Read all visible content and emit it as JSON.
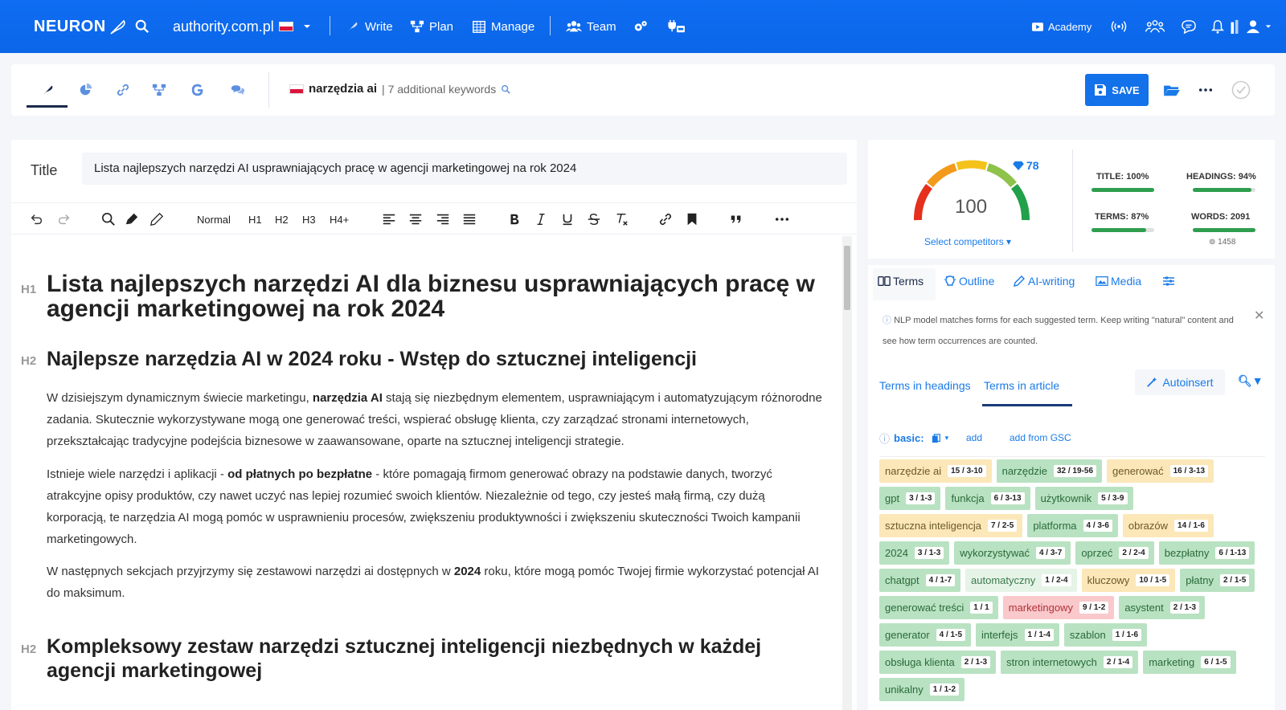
{
  "topnav": {
    "logo": "NEURON",
    "domain": "authority.com.pl",
    "items": {
      "write": "Write",
      "plan": "Plan",
      "manage": "Manage",
      "team": "Team"
    },
    "academy": "Academy"
  },
  "toolbar2": {
    "keyword": "narzędzia ai",
    "additional": "| 7 additional keywords",
    "save": "SAVE"
  },
  "editor": {
    "title_label": "Title",
    "title_value": "Lista najlepszych narzędzi AI usprawniających pracę w agencji marketingowej na rok 2024",
    "format": {
      "normal": "Normal",
      "h1": "H1",
      "h2": "H2",
      "h3": "H3",
      "h4": "H4+"
    },
    "tags": {
      "h1": "H1",
      "h2": "H2"
    },
    "h1": "Lista najlepszych narzędzi AI dla biznesu usprawniających pracę w agencji marketingowej na rok 2024",
    "h2_1": "Najlepsze narzędzia AI w 2024 roku - Wstęp do sztucznej inteligencji",
    "p1a": "W dzisiejszym dynamicznym świecie marketingu, ",
    "p1b": "narzędzia AI",
    "p1c": " stają się niezbędnym elementem, usprawniającym i automatyzującym różnorodne zadania. Skutecznie wykorzystywane mogą one generować treści, wspierać obsługę klienta, czy zarządzać stronami internetowych, przekształcając tradycyjne podejścia biznesowe w zaawansowane, oparte na sztucznej inteligencji strategie.",
    "p2a": "Istnieje wiele narzędzi i aplikacji - ",
    "p2b": "od płatnych po bezpłatne",
    "p2c": " - które pomagają firmom generować obrazy na podstawie danych, tworzyć atrakcyjne opisy produktów, czy nawet uczyć nas lepiej rozumieć swoich klientów. Niezależnie od tego, czy jesteś małą firmą, czy dużą korporacją, te narzędzia AI mogą pomóc w usprawnieniu procesów, zwiększeniu produktywności i zwiększeniu skuteczności Twoich kampanii marketingowych.",
    "p3a": "W następnych sekcjach przyjrzymy się zestawowi narzędzi ai dostępnych w ",
    "p3b": "2024",
    "p3c": " roku, które mogą pomóc Twojej firmie wykorzystać potencjał AI do maksimum.",
    "h2_2": "Kompleksowy zestaw narzędzi sztucznej inteligencji niezbędnych w każdej agencji marketingowej"
  },
  "score": {
    "value": "100",
    "target": "78",
    "select_competitors": "Select competitors",
    "metrics": {
      "title": "TITLE: 100%",
      "headings": "HEADINGS: 94%",
      "terms": "TERMS: 87%",
      "words": "WORDS: 2091",
      "words_target": "1458"
    },
    "fills": {
      "title": 1.0,
      "headings": 0.94,
      "terms": 0.87,
      "words": 1.0
    }
  },
  "panel": {
    "tabs": {
      "terms": "Terms",
      "outline": "Outline",
      "ai": "AI-writing",
      "media": "Media"
    },
    "info": "NLP model matches forms for each suggested term. Keep writing \"natural\" content and see how term occurrences are counted.",
    "sub_headings": "Terms in headings",
    "sub_article": "Terms in article",
    "autoinsert": "Autoinsert",
    "basic": "basic:",
    "add": "add",
    "add_gsc": "add from GSC"
  },
  "terms": [
    {
      "t": "narzędzie ai",
      "c": "15 / 3-10",
      "s": "yellow"
    },
    {
      "t": "narzędzie",
      "c": "32 / 19-56",
      "s": "green"
    },
    {
      "t": "generować",
      "c": "16 / 3-13",
      "s": "yellow"
    },
    {
      "t": "gpt",
      "c": "3 / 1-3",
      "s": "green"
    },
    {
      "t": "funkcja",
      "c": "6 / 3-13",
      "s": "green"
    },
    {
      "t": "użytkownik",
      "c": "5 / 3-9",
      "s": "green"
    },
    {
      "t": "sztuczna inteligencja",
      "c": "7 / 2-5",
      "s": "yellow"
    },
    {
      "t": "platforma",
      "c": "4 / 3-6",
      "s": "green"
    },
    {
      "t": "obrazów",
      "c": "14 / 1-6",
      "s": "yellow"
    },
    {
      "t": "2024",
      "c": "3 / 1-3",
      "s": "green"
    },
    {
      "t": "wykorzystywać",
      "c": "4 / 3-7",
      "s": "green"
    },
    {
      "t": "oprzeć",
      "c": "2 / 2-4",
      "s": "green"
    },
    {
      "t": "bezpłatny",
      "c": "6 / 1-13",
      "s": "green"
    },
    {
      "t": "chatgpt",
      "c": "4 / 1-7",
      "s": "green"
    },
    {
      "t": "automatyczny",
      "c": "1 / 2-4",
      "s": "light"
    },
    {
      "t": "kluczowy",
      "c": "10 / 1-5",
      "s": "yellow"
    },
    {
      "t": "płatny",
      "c": "2 / 1-5",
      "s": "green"
    },
    {
      "t": "generować treści",
      "c": "1 / 1",
      "s": "green"
    },
    {
      "t": "marketingowy",
      "c": "9 / 1-2",
      "s": "red"
    },
    {
      "t": "asystent",
      "c": "2 / 1-3",
      "s": "green"
    },
    {
      "t": "generator",
      "c": "4 / 1-5",
      "s": "green"
    },
    {
      "t": "interfejs",
      "c": "1 / 1-4",
      "s": "green"
    },
    {
      "t": "szablon",
      "c": "1 / 1-6",
      "s": "green"
    },
    {
      "t": "obsługa klienta",
      "c": "2 / 1-3",
      "s": "green"
    },
    {
      "t": "stron internetowych",
      "c": "2 / 1-4",
      "s": "green"
    },
    {
      "t": "marketing",
      "c": "6 / 1-5",
      "s": "green"
    },
    {
      "t": "unikalny",
      "c": "1 / 1-2",
      "s": "green"
    }
  ]
}
